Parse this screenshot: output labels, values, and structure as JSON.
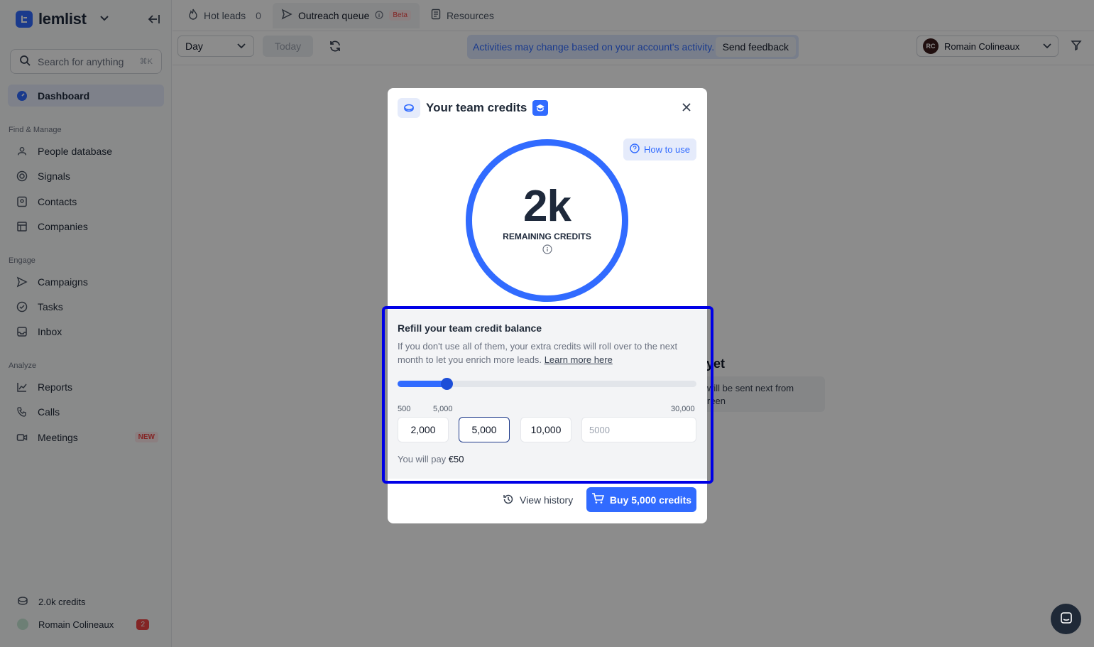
{
  "sidebar": {
    "brand": "lemlist",
    "search": {
      "placeholder": "Search for anything",
      "shortcut": "⌘K"
    },
    "dashboard": "Dashboard",
    "sections": [
      {
        "label": "Find & Manage",
        "items": [
          "People database",
          "Signals",
          "Contacts",
          "Companies"
        ]
      },
      {
        "label": "Engage",
        "items": [
          "Campaigns",
          "Tasks",
          "Inbox"
        ]
      },
      {
        "label": "Analyze",
        "items": [
          "Reports",
          "Calls",
          "Meetings"
        ]
      }
    ],
    "meetings_badge": "NEW",
    "credits": "2.0k credits",
    "user": {
      "name": "Romain Colineaux",
      "notifications": "2"
    }
  },
  "tabs": [
    {
      "label": "Hot leads",
      "count": "0"
    },
    {
      "label": "Outreach queue",
      "badge": "Beta"
    },
    {
      "label": "Resources"
    }
  ],
  "toolbar": {
    "period": "Day",
    "today": "Today",
    "banner": "Activities may change based on your account's activity.",
    "feedback": "Send feedback",
    "user_initials": "RC",
    "user_name": "Romain Colineaux"
  },
  "background": {
    "empty_title": "yet",
    "empty_text_1": "will be sent next from",
    "empty_text_2": "reen"
  },
  "modal": {
    "title": "Your team credits",
    "how_to_use": "How to use",
    "remaining_value": "2k",
    "remaining_label": "REMAINING CREDITS",
    "refill_title": "Refill your team credit balance",
    "refill_desc": "If you don't use all of them, your extra credits will roll over to the next month to let you enrich more leads.",
    "learn_more": "Learn more here",
    "slider": {
      "min": 500,
      "max": 30000,
      "value": 5000,
      "fill_fraction": 0.165,
      "ticks": [
        "500",
        "5,000",
        "30,000"
      ]
    },
    "presets": [
      "2,000",
      "5,000",
      "10,000"
    ],
    "selected_preset": "5,000",
    "custom_placeholder": "5000",
    "pay_prefix": "You will pay",
    "pay_amount": "€50",
    "view_history": "View history",
    "buy": "Buy 5,000 credits"
  },
  "colors": {
    "accent": "#316bff",
    "highlight": "#0000e6"
  }
}
